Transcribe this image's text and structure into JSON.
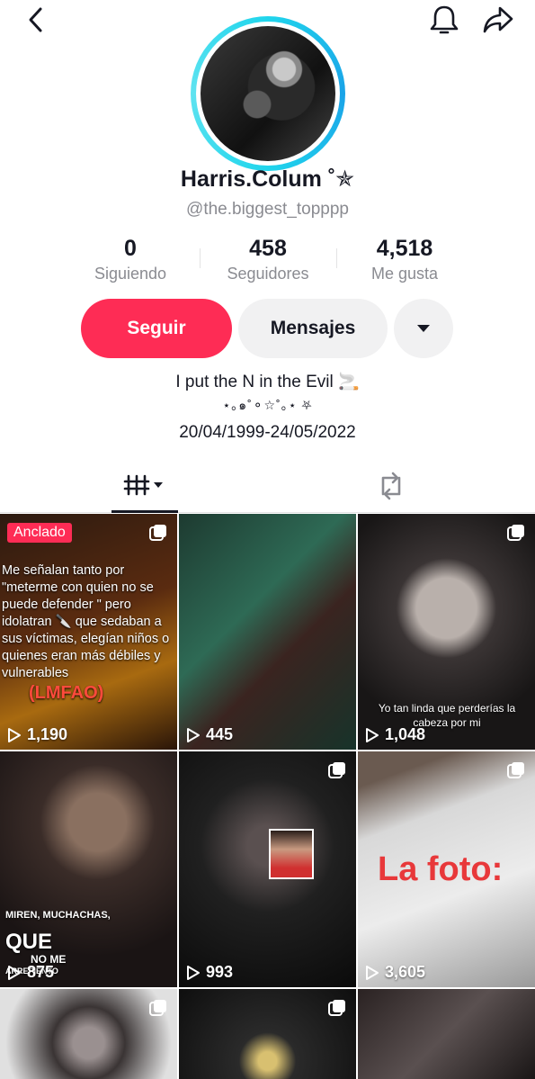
{
  "profile": {
    "display_name": "Harris.Colum ˚✯",
    "handle": "@the.biggest_topppp",
    "stats": [
      {
        "value": "0",
        "label": "Siguiendo"
      },
      {
        "value": "458",
        "label": "Seguidores"
      },
      {
        "value": "4,518",
        "label": "Me gusta"
      }
    ],
    "bio": [
      "I put the N in the Evil 🚬",
      "⋆｡๑˚⚬☆˚｡⋆ ⛧",
      "20/04/1999-24/05/2022"
    ]
  },
  "actions": {
    "follow_label": "Seguir",
    "message_label": "Mensajes"
  },
  "tabs": [
    {
      "name": "videos"
    },
    {
      "name": "reposts"
    }
  ],
  "videos": [
    {
      "views": "1,190",
      "pinned_label": "Anclado",
      "text": "Me señalan tanto por \"meterme con quien no se puede defender \" pero idolatran 🔪 que sedaban a sus víctimas, elegían niños o quienes eran más débiles y vulnerables",
      "highlight": "(LMFAO)"
    },
    {
      "views": "445"
    },
    {
      "views": "1,048",
      "caption": "Yo tan linda que perderías la cabeza por mi"
    },
    {
      "views": "875",
      "caption_top": "MIREN, MUCHACHAS,",
      "caption_big": "QUE",
      "caption_bottom": "NO ME",
      "caption_tail": "ARREPIENTO"
    },
    {
      "views": "993"
    },
    {
      "views": "3,605",
      "caption": "La foto:"
    },
    {
      "views": ""
    },
    {
      "views": ""
    },
    {
      "views": ""
    }
  ],
  "colors": {
    "accent": "#fe2c55",
    "ring": "#20d5ec",
    "muted": "#8a8b91"
  }
}
